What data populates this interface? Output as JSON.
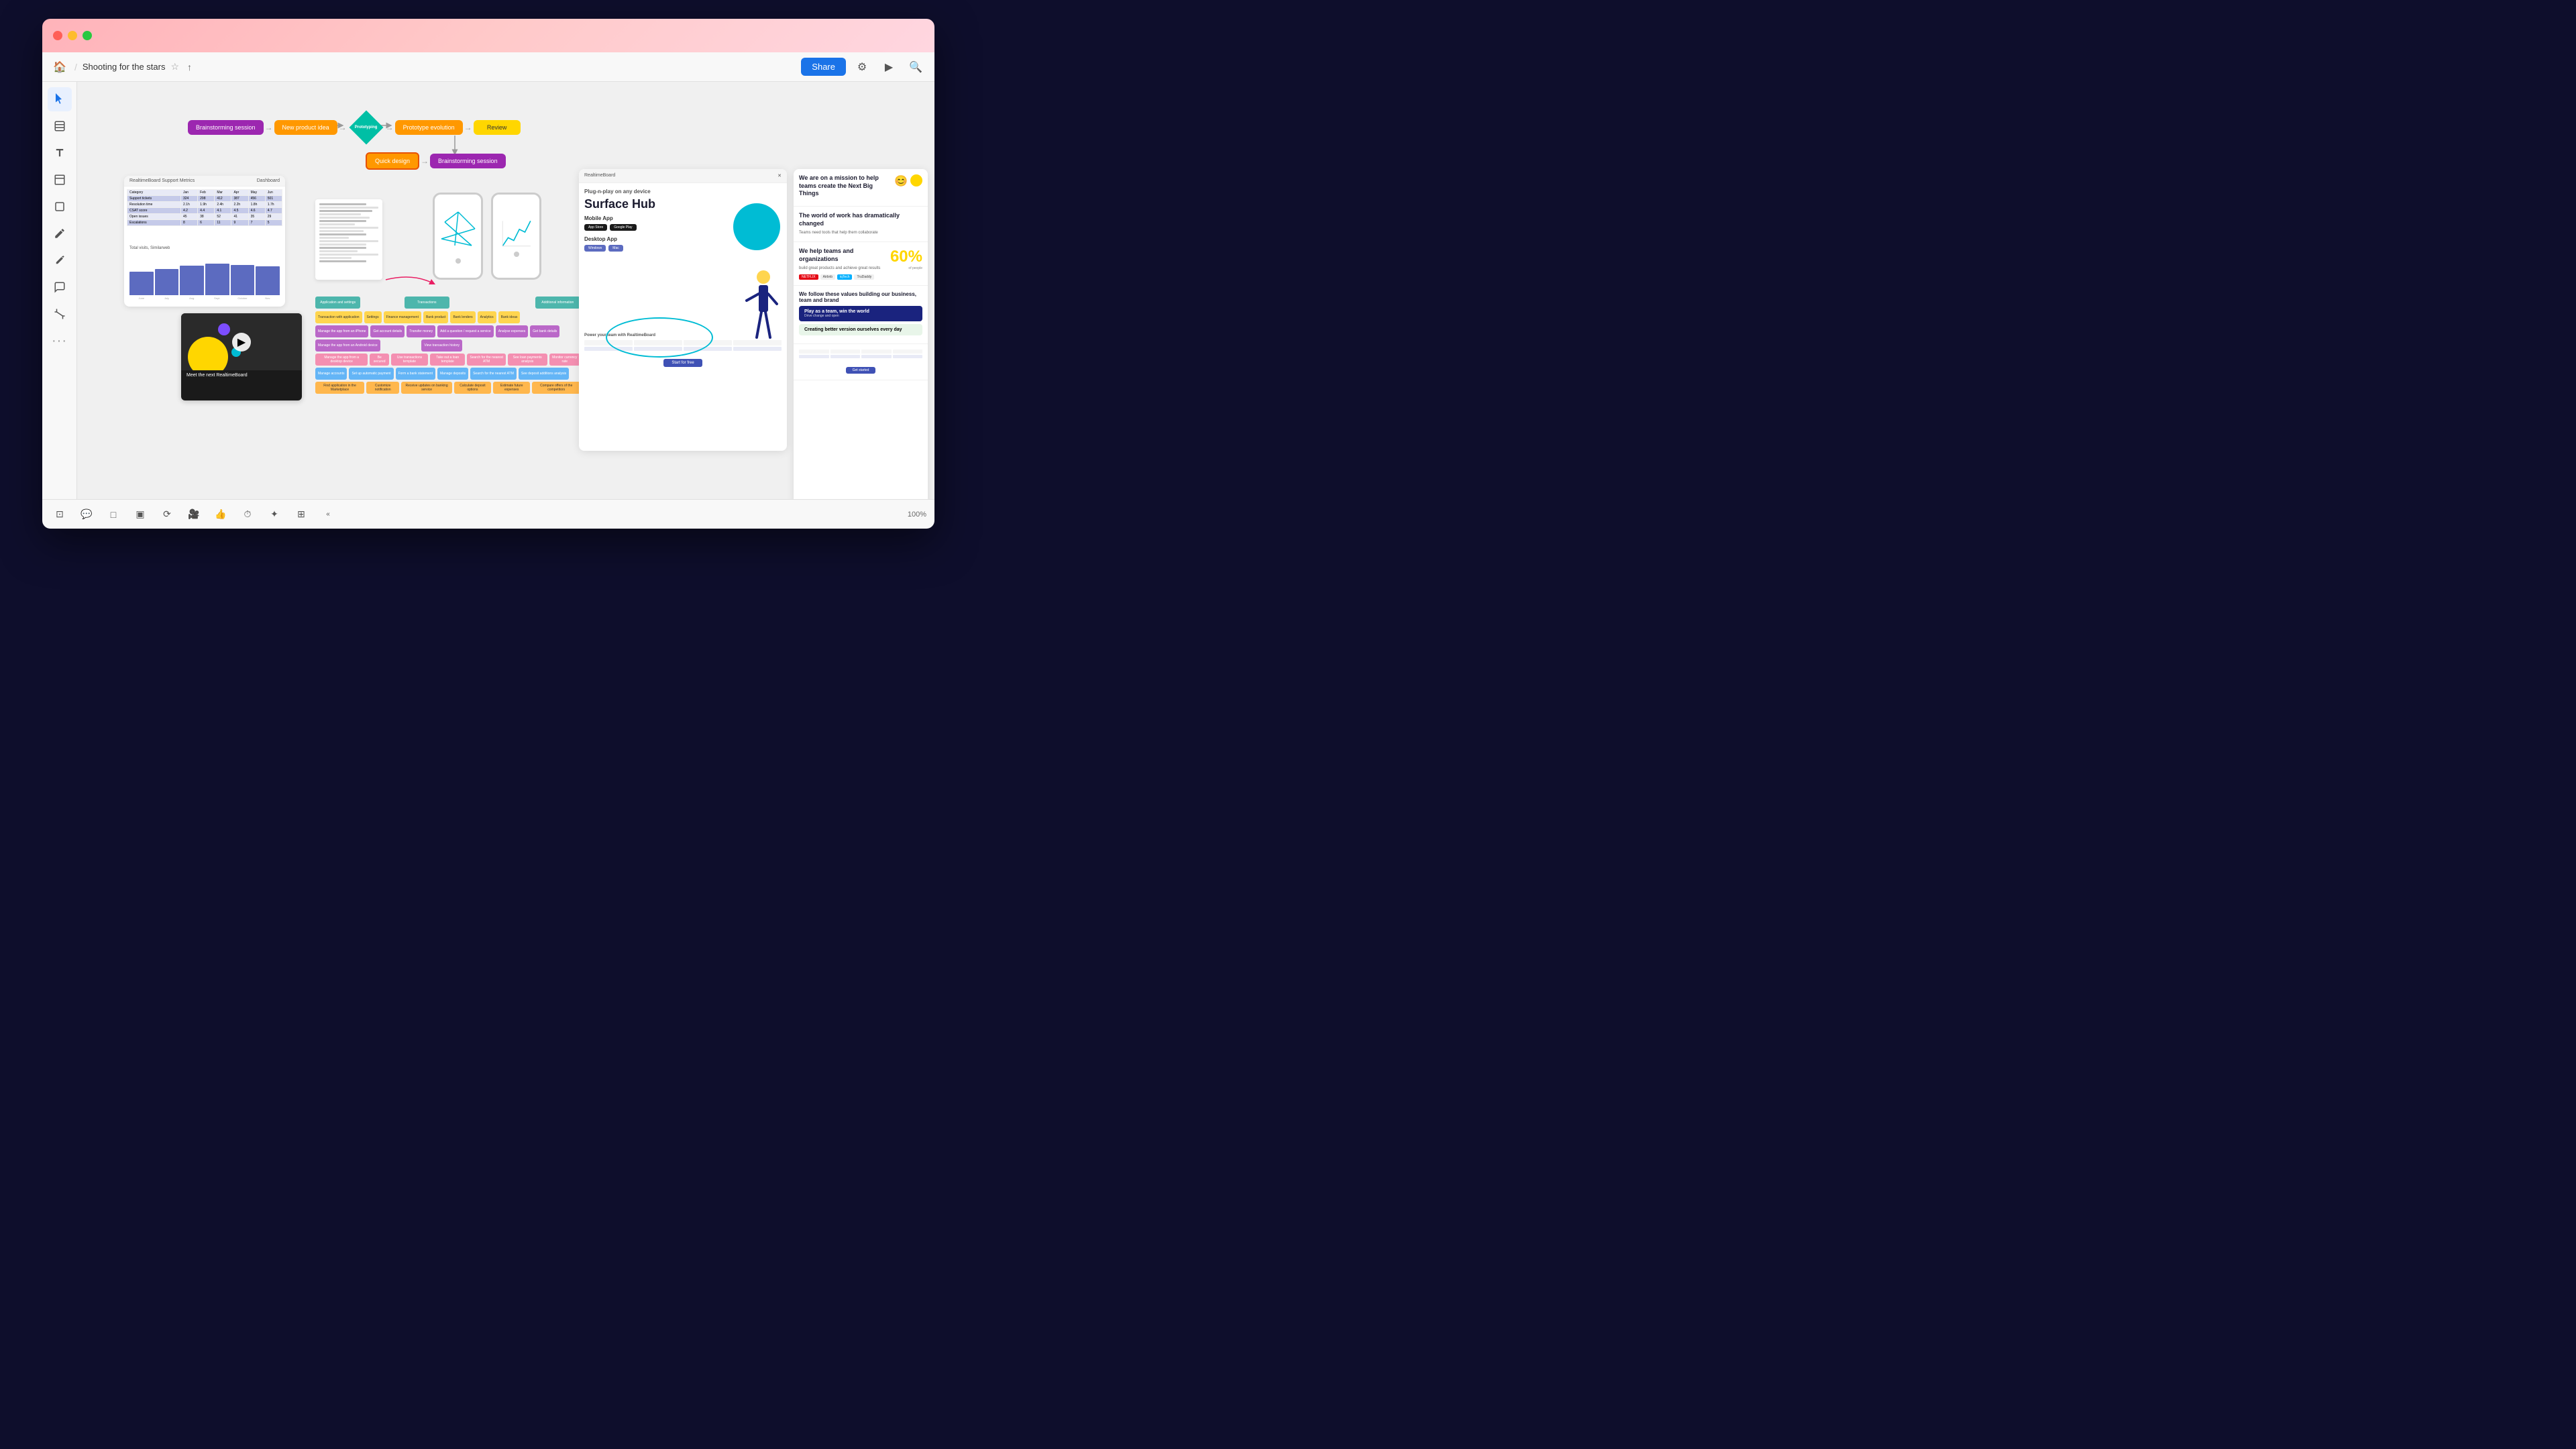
{
  "app": {
    "title": "Shooting for the stars",
    "zoom": "100%"
  },
  "titlebar": {
    "buttons": [
      "close",
      "minimize",
      "maximize"
    ]
  },
  "toolbar": {
    "home_label": "🏠",
    "title": "Shooting for the stars",
    "star_icon": "☆",
    "export_icon": "↑",
    "share_button": "Share"
  },
  "flowchart": {
    "nodes": [
      {
        "label": "Brainstorming session",
        "color": "#9c27b0"
      },
      {
        "label": "New product idea",
        "color": "#ff9800"
      },
      {
        "label": "Prototyping",
        "color": "#00bfa5"
      },
      {
        "label": "Prototype evolution",
        "color": "#ff9800"
      },
      {
        "label": "Review",
        "color": "#ffd600"
      },
      {
        "label": "Quick design",
        "color": "#ff9800"
      },
      {
        "label": "Brainstorming session",
        "color": "#9c27b0"
      }
    ]
  },
  "dashboard": {
    "title": "RealtimeBoard Support Metrics",
    "label": "Dashboard",
    "chart_title": "Total visits, Similarweb",
    "bars": [
      {
        "month": "June",
        "height": 55,
        "value": "719 000"
      },
      {
        "month": "July",
        "height": 62,
        "value": "834 000"
      },
      {
        "month": "August",
        "height": 70,
        "value": "849 000"
      },
      {
        "month": "September",
        "height": 75,
        "value": "869 500"
      },
      {
        "month": "October",
        "height": 72,
        "value": "874 700"
      },
      {
        "month": "November",
        "height": 68,
        "value": "874 700"
      }
    ]
  },
  "video": {
    "title": "Meet the next RealtimeBoard"
  },
  "surface_hub": {
    "title": "Surface Hub",
    "subtitle": "Plug-n-play on any device",
    "mobile_app": "Mobile App",
    "desktop_app": "Desktop App"
  },
  "company_values": {
    "mission": "We are on a mission to help teams create the Next Big Things",
    "world_of_work": "The world of work has dramatically changed",
    "help_teams": "We help teams and organizations",
    "percentage": "60%",
    "values_header": "We follow these values building our business, team and brand",
    "value1_title": "Play as a team, win the world",
    "value1_desc": "Drive change and open",
    "value2_title": "Creating better version ourselves every day",
    "value2_desc": ""
  },
  "tools": {
    "left": [
      "cursor",
      "frame",
      "text",
      "sticky",
      "shape",
      "pen",
      "highlighter",
      "comment",
      "crop",
      "more"
    ],
    "bottom": [
      "frame",
      "comment",
      "sticky",
      "screen",
      "export",
      "video",
      "thumbsup",
      "timer",
      "magic",
      "grid"
    ]
  },
  "story_map": {
    "rows": [
      {
        "cards": [
          "Application and settings",
          "",
          "Transactions",
          "",
          "",
          "Additional information"
        ]
      },
      {
        "cards": [
          "Transaction with application",
          "Settings",
          "Finance management",
          "Bank product",
          "Bank lenders",
          "Analytics",
          "Bank ideas"
        ]
      },
      {
        "cards": [
          "Manage the app from an iPhone",
          "Get account details",
          "Transfer money",
          "Add a question / request a service",
          "Analyse expenses",
          "Get bank details"
        ]
      },
      {
        "cards": [
          "Manage the app from an Android device",
          "",
          "View transaction history",
          "",
          "",
          ""
        ]
      },
      {
        "cards": [
          "Manage the app from a desktop device",
          "Be secured",
          "Use transactions template",
          "Take out a loan template",
          "Search for the nearest ATM",
          "See loan payments analysis",
          "Monitor currency rate"
        ]
      },
      {
        "cards": [
          "Manage accounts",
          "Set up automatic payment",
          "Form a bank statement",
          "Manage deposits",
          "Search for the nearest ATM",
          "See deposit additions analysis",
          ""
        ]
      },
      {
        "cards": [
          "Find application in the Marketplace",
          "Customize notification",
          "Receive updates on banking service",
          "Calculate deposit options",
          "Estimate future expenses",
          "Compare offers of the competitors"
        ]
      }
    ]
  }
}
